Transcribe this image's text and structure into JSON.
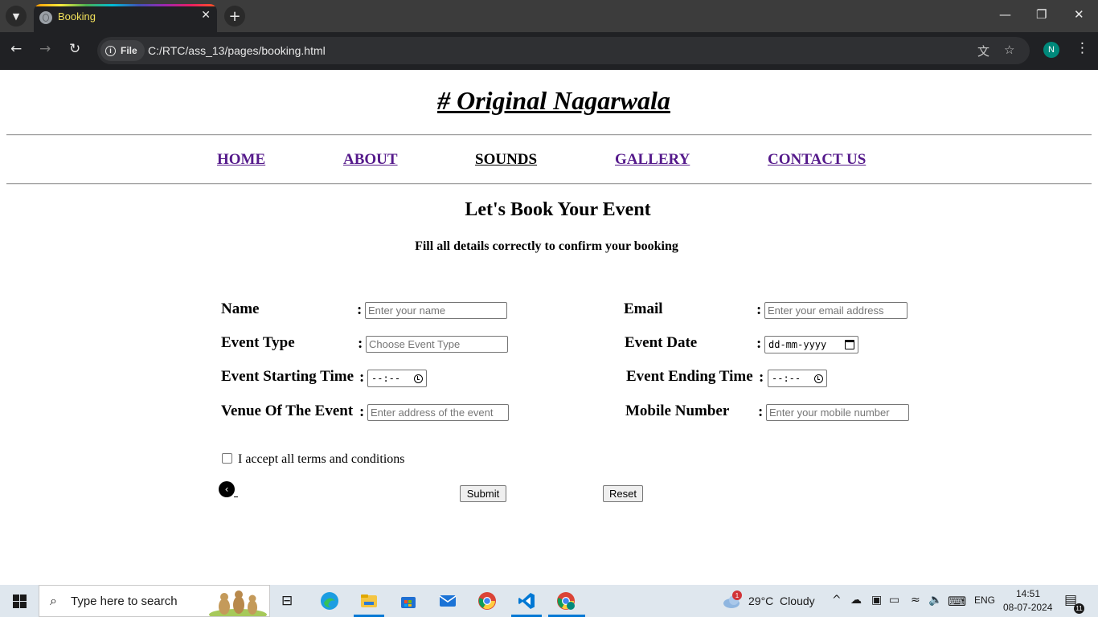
{
  "browser": {
    "tab_title": "Booking",
    "file_chip": "File",
    "url": "C:/RTC/ass_13/pages/booking.html",
    "profile_initial": "N"
  },
  "site": {
    "title": "# Original Nagarwala",
    "nav": {
      "home": "HOME",
      "about": "ABOUT",
      "sounds": "SOUNDS",
      "gallery": "GALLERY",
      "contact": "CONTACT US"
    }
  },
  "form": {
    "heading": "Let's Book Your Event",
    "subheading": "Fill all details correctly to confirm your booking",
    "colon": ":",
    "name_label": "Name",
    "name_placeholder": "Enter your name",
    "email_label": "Email",
    "email_placeholder": "Enter your email address",
    "event_type_label": "Event Type",
    "event_type_placeholder": "Choose Event Type",
    "event_date_label": "Event Date",
    "event_date_value": "dd-mm-yyyy",
    "start_time_label": "Event Starting Time",
    "start_time_value": "--:--",
    "end_time_label": "Event Ending Time",
    "end_time_value": "--:--",
    "venue_label": "Venue Of The Event",
    "venue_placeholder": "Enter address of the event",
    "mobile_label": "Mobile Number",
    "mobile_placeholder": "Enter your mobile number",
    "terms_label": "I accept all terms and conditions",
    "submit_label": "Submit",
    "reset_label": "Reset"
  },
  "taskbar": {
    "search_placeholder": "Type here to search",
    "weather_badge": "1",
    "weather": "29°C  Cloudy",
    "language": "ENG",
    "time": "14:51",
    "date": "08-07-2024",
    "notification_count": "11"
  }
}
